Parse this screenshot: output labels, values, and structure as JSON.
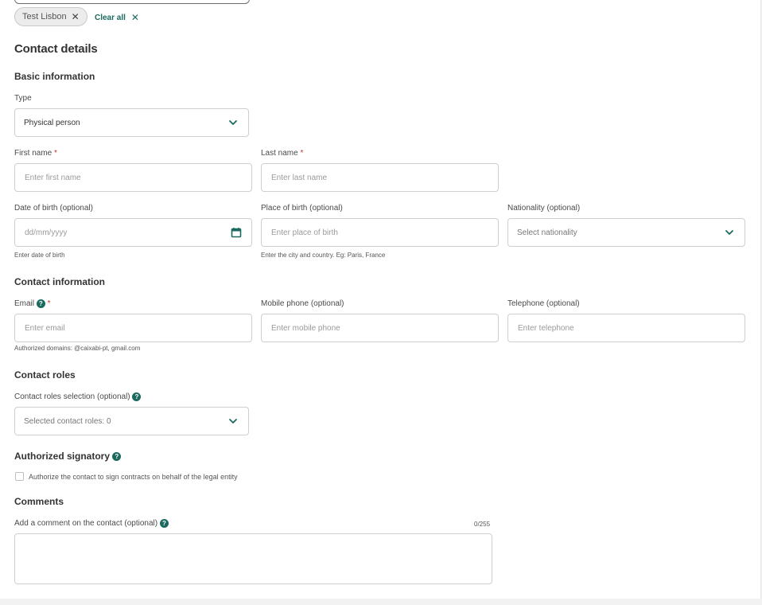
{
  "filter": {
    "chip_label": "Test Lisbon",
    "clear_all_label": "Clear all"
  },
  "section_title": "Contact details",
  "basic": {
    "title": "Basic information",
    "type_label": "Type",
    "type_value": "Physical person",
    "first_name_label": "First name",
    "first_name_placeholder": "Enter first name",
    "last_name_label": "Last name",
    "last_name_placeholder": "Enter last name",
    "required_mark": "*",
    "dob_label": "Date of birth (optional)",
    "dob_placeholder": "dd/mm/yyyy",
    "dob_helper": "Enter date of birth",
    "pob_label": "Place of birth (optional)",
    "pob_placeholder": "Enter place of birth",
    "pob_helper": "Enter the city and country. Eg: Paris, France",
    "nationality_label": "Nationality (optional)",
    "nationality_placeholder": "Select nationality"
  },
  "contact": {
    "title": "Contact information",
    "email_label": "Email",
    "email_placeholder": "Enter email",
    "email_helper": "Authorized domains: @caixabi-pt, gmail.com",
    "mobile_label": "Mobile phone (optional)",
    "mobile_placeholder": "Enter mobile phone",
    "telephone_label": "Telephone (optional)",
    "telephone_placeholder": "Enter telephone"
  },
  "roles": {
    "title": "Contact roles",
    "selection_label": "Contact roles selection (optional)",
    "selection_value": "Selected contact roles: 0"
  },
  "signatory": {
    "title": "Authorized signatory",
    "checkbox_label": "Authorize the contact to sign contracts on behalf of the legal entity"
  },
  "comments": {
    "title": "Comments",
    "label": "Add a comment on the contact (optional)",
    "counter": "0/255"
  },
  "icons": {
    "close": "close-icon",
    "chevron": "chevron-down-icon",
    "calendar": "calendar-icon",
    "help": "help-icon"
  },
  "colors": {
    "accent": "#1a6a5f",
    "required": "#c0392b"
  }
}
